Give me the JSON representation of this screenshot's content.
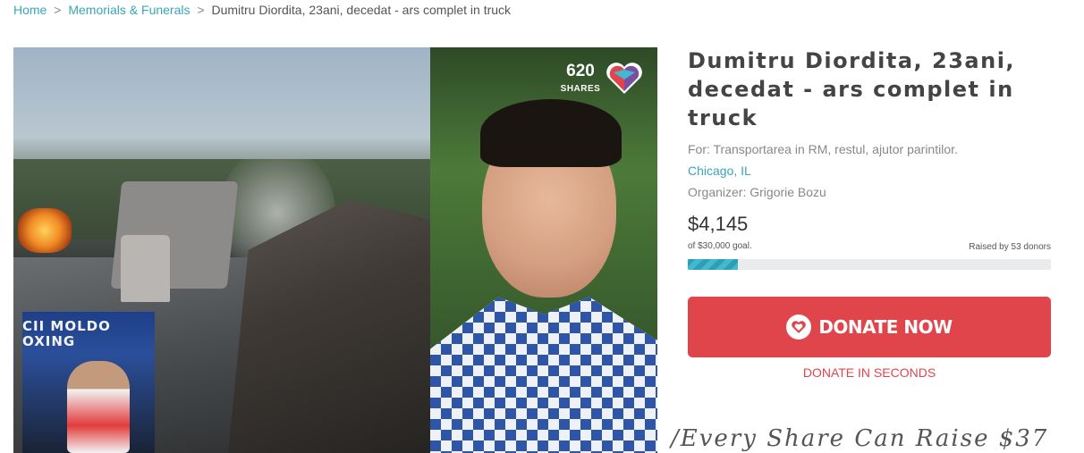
{
  "breadcrumb": {
    "home": "Home",
    "sep1": ">",
    "category": "Memorials & Funerals",
    "sep2": ">",
    "current": "Dumitru Diordita, 23ani, decedat - ars complet in truck"
  },
  "media": {
    "shares_count": "620",
    "shares_label": "SHARES",
    "inset_text": "CII MOLDO\nOXING"
  },
  "campaign": {
    "title": "Dumitru Diordita, 23ani, decedat - ars complet in truck",
    "for_text": "For: Transportarea in RM, restul, ajutor parintilor.",
    "location": "Chicago, IL",
    "organizer": "Organizer: Grigorie Bozu"
  },
  "funding": {
    "amount": "$4,145",
    "goal": "of $30,000 goal.",
    "raised_by": "Raised by 53 donors",
    "progress_fraction": 0.138
  },
  "actions": {
    "donate_now": "DONATE NOW",
    "donate_in_seconds": "DONATE IN SECONDS"
  },
  "promo": {
    "share_raise": "/Every Share Can Raise $37"
  },
  "colors": {
    "link": "#3aa5b8",
    "donate": "#e0454c",
    "progress": "#43b9cf"
  }
}
